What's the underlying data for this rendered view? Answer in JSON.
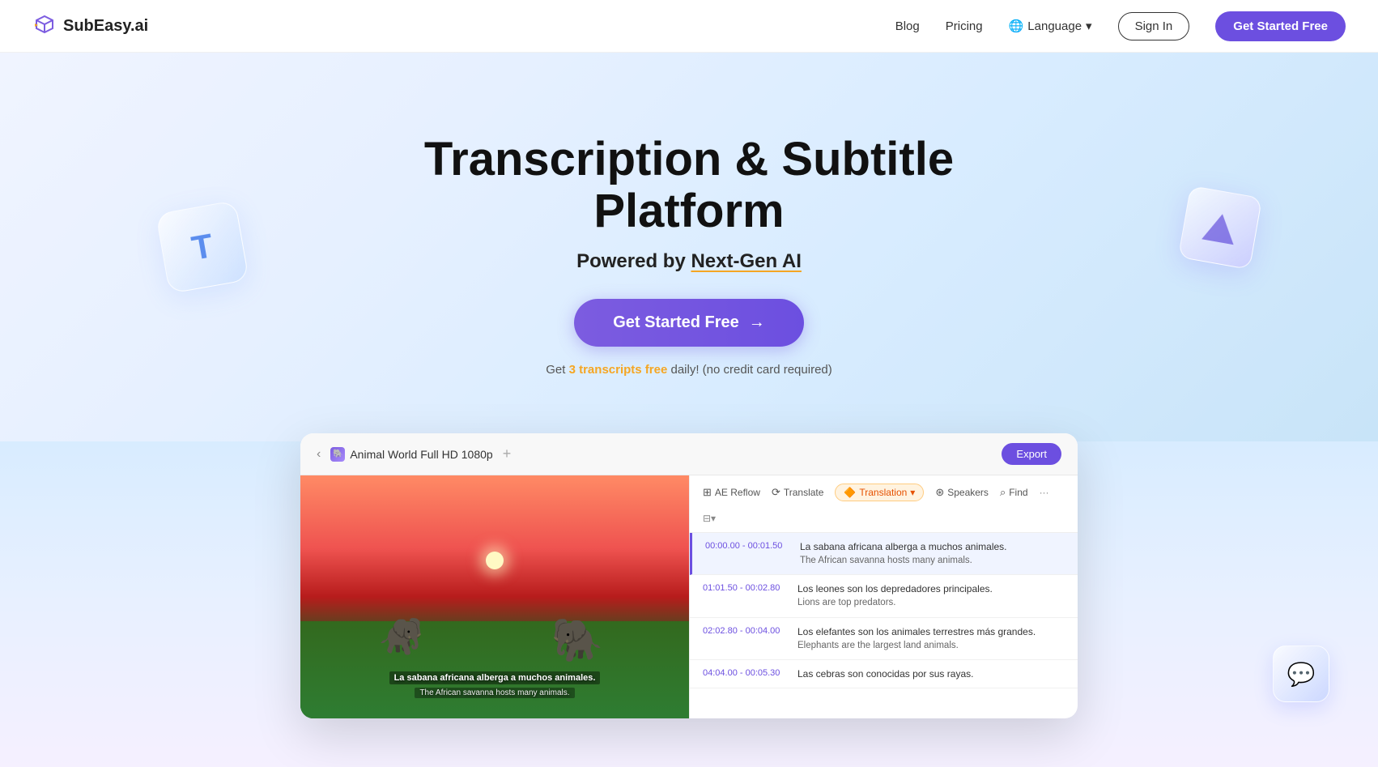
{
  "nav": {
    "logo_text": "SubEasy.ai",
    "blog_label": "Blog",
    "pricing_label": "Pricing",
    "language_label": "Language",
    "signin_label": "Sign In",
    "cta_label": "Get Started Free"
  },
  "hero": {
    "title": "Transcription & Subtitle Platform",
    "subtitle_prefix": "Powered by ",
    "subtitle_highlight": "Next-Gen AI",
    "cta_button": "Get Started Free",
    "subtext_prefix": "Get ",
    "subtext_highlight": "3 transcripts free",
    "subtext_suffix": " daily! (no credit card required)"
  },
  "app": {
    "titlebar": {
      "tab_name": "Animal World Full HD 1080p",
      "export_label": "Export"
    },
    "toolbar": {
      "reflow": "AE Reflow",
      "translate": "Translate",
      "translation": "Translation",
      "speakers": "Speakers",
      "find": "Find"
    },
    "transcript_rows": [
      {
        "time": "00:00.00 - 00:01.50",
        "line1": "La sabana africana alberga a muchos animales.",
        "line2": "The African savanna hosts many animals.",
        "active": true
      },
      {
        "time": "01:01.50 - 00:02.80",
        "line1": "Los leones son los depredadores principales.",
        "line2": "Lions are top predators.",
        "active": false
      },
      {
        "time": "02:02.80 - 00:04.00",
        "line1": "Los elefantes son los animales terrestres más grandes.",
        "line2": "Elephants are the largest land animals.",
        "active": false
      },
      {
        "time": "04:04.00 - 00:05.30",
        "line1": "Las cebras son conocidas por sus rayas.",
        "line2": "",
        "active": false
      }
    ],
    "video": {
      "subtitle_line1": "La sabana africana alberga a muchos animales.",
      "subtitle_line2": "The African savanna hosts many animals."
    }
  },
  "colors": {
    "accent_purple": "#6c4fe0",
    "accent_orange": "#f5a623",
    "nav_bg": "#ffffff"
  }
}
